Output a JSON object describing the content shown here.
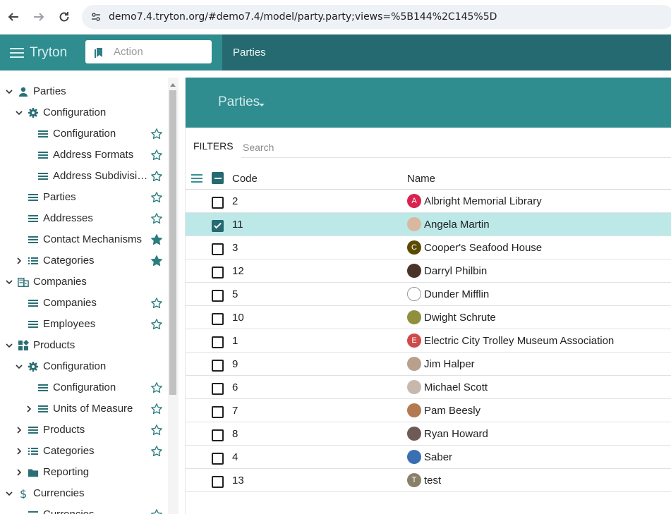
{
  "browser": {
    "url": "demo7.4.tryton.org/#demo7.4/model/party.party;views=%5B144%2C145%5D"
  },
  "header": {
    "brand": "Tryton",
    "action_placeholder": "Action",
    "active_tab": "Parties"
  },
  "sidebar": {
    "items": [
      {
        "label": "Parties",
        "starred": null
      },
      {
        "label": "Configuration",
        "starred": null
      },
      {
        "label": "Configuration",
        "starred": false
      },
      {
        "label": "Address Formats",
        "starred": false
      },
      {
        "label": "Address Subdivisi…",
        "starred": false
      },
      {
        "label": "Parties",
        "starred": false
      },
      {
        "label": "Addresses",
        "starred": false
      },
      {
        "label": "Contact Mechanisms",
        "starred": true
      },
      {
        "label": "Categories",
        "starred": true
      },
      {
        "label": "Companies",
        "starred": null
      },
      {
        "label": "Companies",
        "starred": false
      },
      {
        "label": "Employees",
        "starred": false
      },
      {
        "label": "Products",
        "starred": null
      },
      {
        "label": "Configuration",
        "starred": null
      },
      {
        "label": "Configuration",
        "starred": false
      },
      {
        "label": "Units of Measure",
        "starred": false
      },
      {
        "label": "Products",
        "starred": false
      },
      {
        "label": "Categories",
        "starred": false
      },
      {
        "label": "Reporting",
        "starred": null
      },
      {
        "label": "Currencies",
        "starred": null
      },
      {
        "label": "Currencies",
        "starred": false
      }
    ]
  },
  "main": {
    "title": "Parties",
    "filters_label": "FILTERS",
    "search_placeholder": "Search",
    "columns": {
      "code": "Code",
      "name": "Name"
    },
    "rows": [
      {
        "code": "2",
        "name": "Albright Memorial Library",
        "avatar": "A",
        "avatar_color": "#d9224f",
        "selected": false
      },
      {
        "code": "11",
        "name": "Angela Martin",
        "avatar": "",
        "avatar_color": "#d9b8a0",
        "selected": true
      },
      {
        "code": "3",
        "name": "Cooper's Seafood House",
        "avatar": "C",
        "avatar_color": "#5b4a00",
        "selected": false
      },
      {
        "code": "12",
        "name": "Darryl Philbin",
        "avatar": "",
        "avatar_color": "#4a3327",
        "selected": false
      },
      {
        "code": "5",
        "name": "Dunder Mifflin",
        "avatar": "",
        "avatar_color": "#ffffff",
        "selected": false
      },
      {
        "code": "10",
        "name": "Dwight Schrute",
        "avatar": "",
        "avatar_color": "#8f8f3e",
        "selected": false
      },
      {
        "code": "1",
        "name": "Electric City Trolley Museum Association",
        "avatar": "E",
        "avatar_color": "#cf4a4a",
        "selected": false
      },
      {
        "code": "9",
        "name": "Jim Halper",
        "avatar": "",
        "avatar_color": "#b9a08c",
        "selected": false
      },
      {
        "code": "6",
        "name": "Michael Scott",
        "avatar": "",
        "avatar_color": "#c7b8ad",
        "selected": false
      },
      {
        "code": "7",
        "name": "Pam Beesly",
        "avatar": "",
        "avatar_color": "#b37a52",
        "selected": false
      },
      {
        "code": "8",
        "name": "Ryan Howard",
        "avatar": "",
        "avatar_color": "#6f5b55",
        "selected": false
      },
      {
        "code": "4",
        "name": "Saber",
        "avatar": "",
        "avatar_color": "#3a6fb4",
        "selected": false
      },
      {
        "code": "13",
        "name": "test",
        "avatar": "T",
        "avatar_color": "#8a7f69",
        "selected": false
      }
    ]
  },
  "colors": {
    "brand_teal": "#2f8c8f",
    "header_dark": "#256a70",
    "selected_row": "#bde8e8",
    "star": "#2a7d80"
  }
}
